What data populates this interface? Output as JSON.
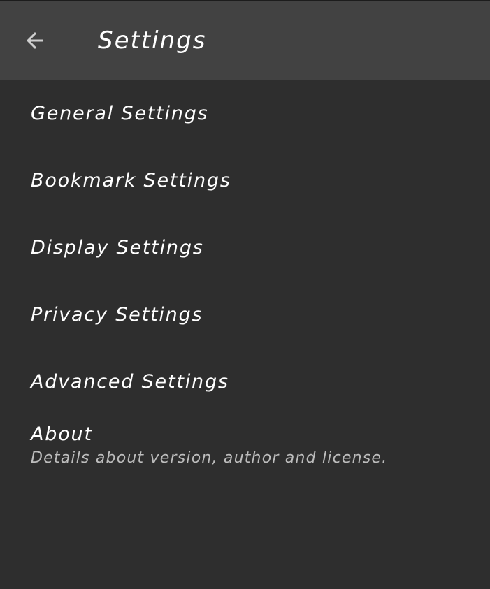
{
  "toolbar": {
    "title": "Settings",
    "back_icon": "arrow-left-icon"
  },
  "items": [
    {
      "title": "General Settings"
    },
    {
      "title": "Bookmark Settings"
    },
    {
      "title": "Display Settings"
    },
    {
      "title": "Privacy Settings"
    },
    {
      "title": "Advanced Settings"
    },
    {
      "title": "About",
      "summary": "Details about version, author and license."
    }
  ],
  "colors": {
    "toolbar_bg": "#424242",
    "page_bg": "#2e2e2e",
    "title_text": "#ffffff",
    "summary_text": "#bdbdbd"
  }
}
